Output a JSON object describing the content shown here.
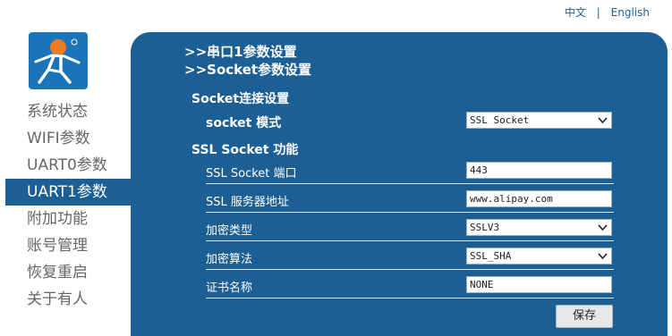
{
  "header": {
    "lang_zh": "中文",
    "lang_sep": "|",
    "lang_en": "English"
  },
  "nav": {
    "items": [
      {
        "label": "系统状态",
        "active": false
      },
      {
        "label": "WIFI参数",
        "active": false
      },
      {
        "label": "UART0参数",
        "active": false
      },
      {
        "label": "UART1参数",
        "active": true
      },
      {
        "label": "附加功能",
        "active": false
      },
      {
        "label": "账号管理",
        "active": false
      },
      {
        "label": "恢复重启",
        "active": false
      },
      {
        "label": "关于有人",
        "active": false
      }
    ]
  },
  "breadcrumbs": {
    "line1": ">>串口1参数设置",
    "line2": ">>Socket参数设置"
  },
  "socket_section": {
    "title": "Socket连接设置",
    "mode_label": "socket 模式",
    "mode_value": "SSL Socket"
  },
  "ssl_section": {
    "title": "SSL Socket 功能",
    "port_label": "SSL Socket 端口",
    "port_value": "443",
    "server_label": "SSL 服务器地址",
    "server_value": "www.alipay.com",
    "encryption_label": "加密类型",
    "encryption_value": "SSLV3",
    "algorithm_label": "加密算法",
    "algorithm_value": "SSL_SHA",
    "cert_label": "证书名称",
    "cert_value": "NONE"
  },
  "actions": {
    "save_label": "保存"
  },
  "colors": {
    "panel": "#1c5f94",
    "logo_bg": "#1b74b8",
    "logo_figure": "#f07b22",
    "nav_text": "#666666"
  }
}
